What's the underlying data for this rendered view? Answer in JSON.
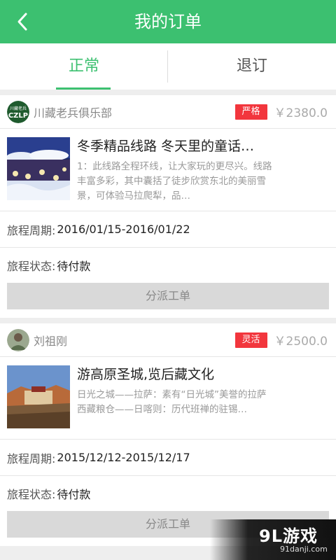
{
  "header": {
    "title": "我的订单"
  },
  "tabs": [
    {
      "label": "正常",
      "active": true
    },
    {
      "label": "退订",
      "active": false
    }
  ],
  "orders": [
    {
      "shop_name": "川藏老兵俱乐部",
      "tag": "严格",
      "price": "￥2380.0",
      "title": "冬季精品线路 冬天里的童话…",
      "desc": "1：此线路全程环线，让大家玩的更尽兴。线路丰富多彩，其中囊括了徒步欣赏东北的美丽雪景，可体验马拉爬犁，品…",
      "period_label": "旅程周期:",
      "period_value": "2016/01/15-2016/01/22",
      "status_label": "旅程状态:",
      "status_value": "待付款",
      "button": "分派工单"
    },
    {
      "shop_name": "刘祖刚",
      "tag": "灵活",
      "price": "￥2500.0",
      "title": "游高原圣城,览后藏文化",
      "desc": "日光之城——拉萨：素有“日光城”美誉的拉萨\n西藏粮仓——日喀则：历代班禅的驻锡…",
      "period_label": "旅程周期:",
      "period_value": "2015/12/12-2015/12/17",
      "status_label": "旅程状态:",
      "status_value": "待付款",
      "button": "分派工单"
    }
  ],
  "watermark": {
    "main": "9L游戏",
    "sub": "91danji.com"
  },
  "colors": {
    "accent": "#3cc070",
    "tag": "#f2363d"
  }
}
